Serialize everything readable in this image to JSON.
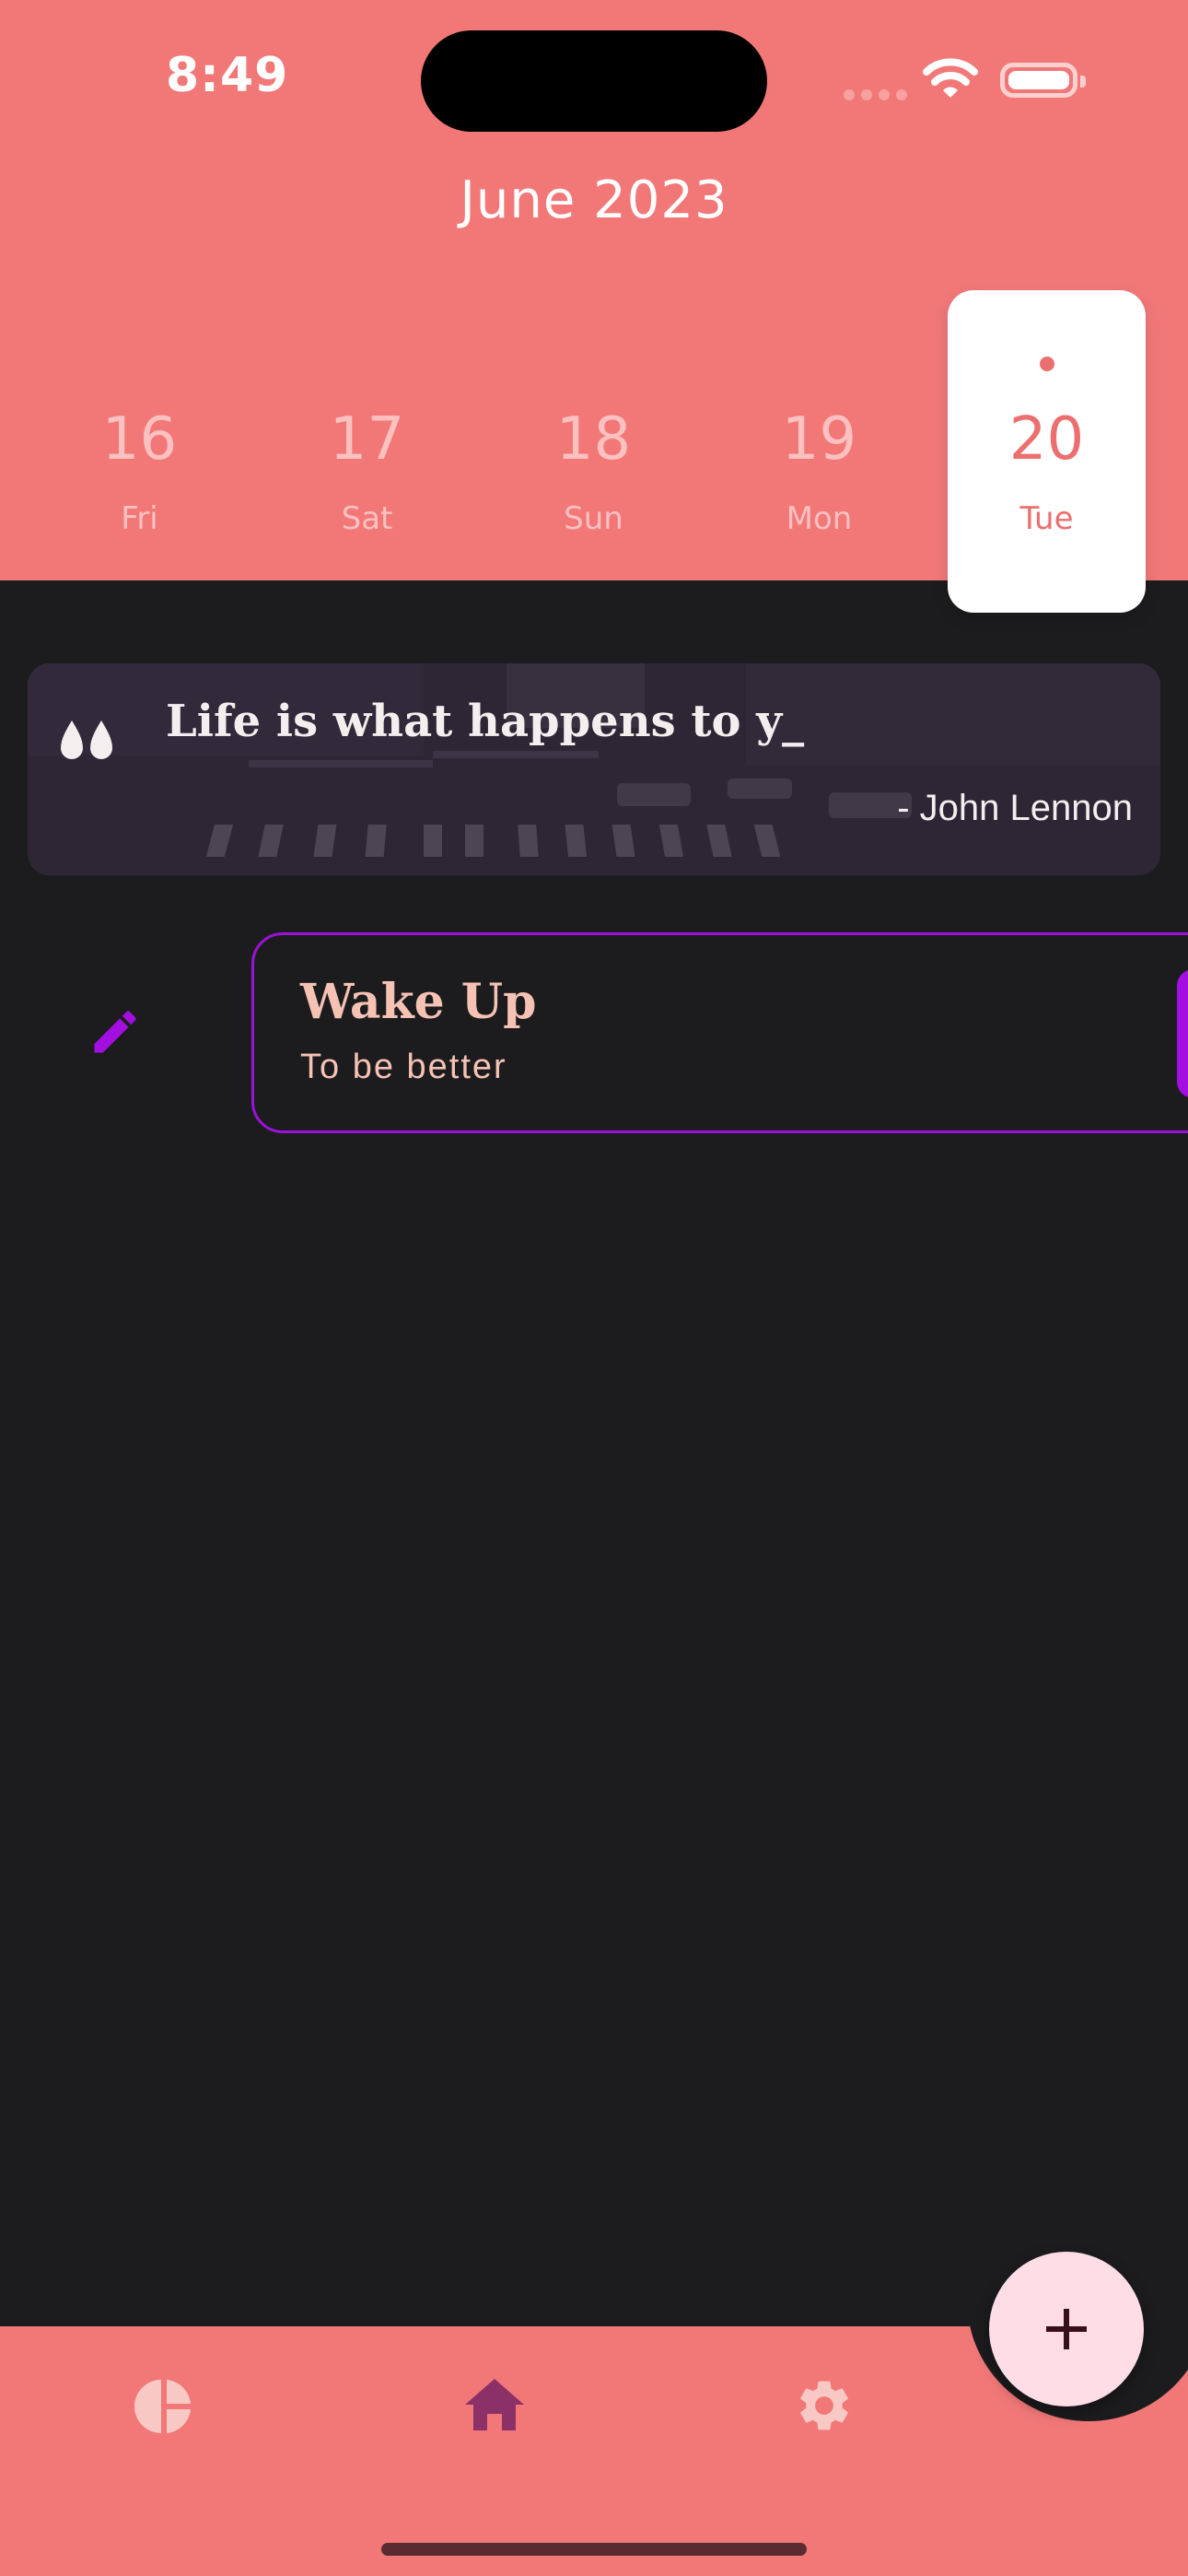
{
  "status_bar": {
    "time": "8:49"
  },
  "header": {
    "month_label": "June 2023",
    "days": [
      {
        "num": "16",
        "weekday": "Fri"
      },
      {
        "num": "17",
        "weekday": "Sat"
      },
      {
        "num": "18",
        "weekday": "Sun"
      },
      {
        "num": "19",
        "weekday": "Mon"
      },
      {
        "num": "20",
        "weekday": "Tue",
        "selected": true
      }
    ]
  },
  "quote": {
    "text": "Life is what happens to y_",
    "author": "- John Lennon"
  },
  "habits": [
    {
      "title": "Wake Up",
      "subtitle": "To be better"
    }
  ],
  "colors": {
    "header_bg": "#f27878",
    "background": "#1c1c1f",
    "accent_purple": "#9b12d8",
    "habit_text": "#f5c2b4",
    "fab_bg": "#fedde6"
  },
  "nav": {
    "items": [
      {
        "icon": "pie-chart-icon"
      },
      {
        "icon": "home-icon",
        "active": true
      },
      {
        "icon": "gear-icon"
      }
    ],
    "fab_icon": "plus-icon"
  }
}
